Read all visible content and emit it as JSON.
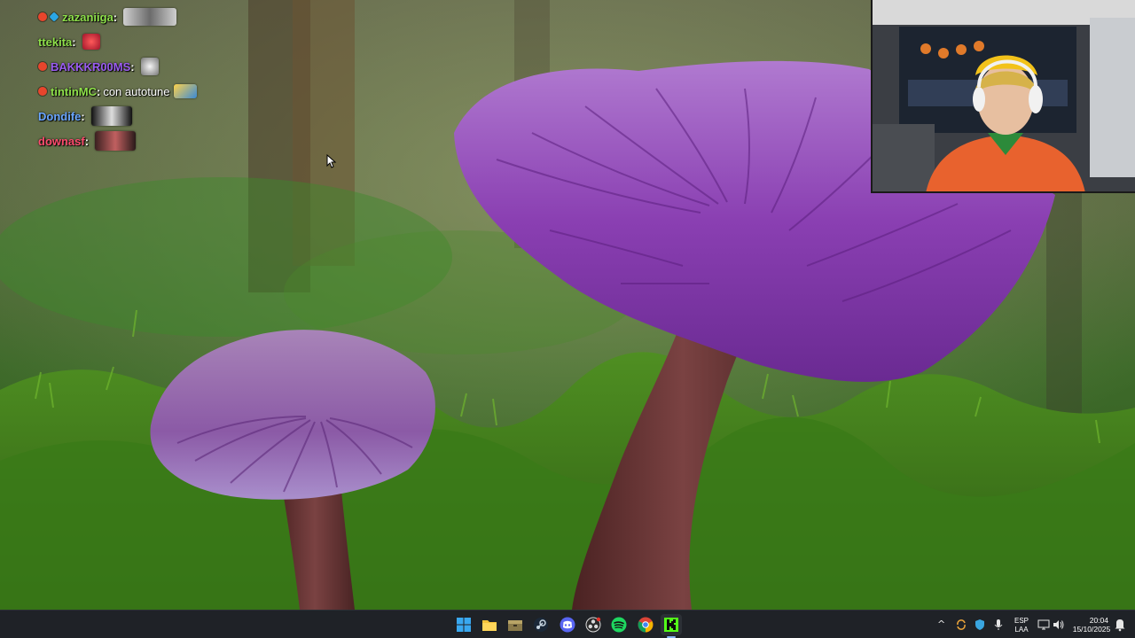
{
  "chat": {
    "messages": [
      {
        "user": "zazaniiga",
        "color": "#8ee04a",
        "badges": [
          "red",
          "blue"
        ],
        "text": ""
      },
      {
        "user": "ttekita",
        "color": "#8ee04a",
        "badges": [],
        "text": ""
      },
      {
        "user": "BAKKKR00MS",
        "color": "#9a5cf0",
        "badges": [
          "red"
        ],
        "text": ""
      },
      {
        "user": "tintinMC",
        "color": "#8ee04a",
        "badges": [
          "red"
        ],
        "text": "con autotune"
      },
      {
        "user": "Dondife",
        "color": "#6aa6ff",
        "badges": [],
        "text": ""
      },
      {
        "user": "downasf",
        "color": "#ff4b6e",
        "badges": [],
        "text": ""
      }
    ],
    "separator": ":"
  },
  "taskbar": {
    "apps": [
      {
        "name": "start-button",
        "icon": "windows-logo-icon"
      },
      {
        "name": "file-explorer-button",
        "icon": "folder-icon"
      },
      {
        "name": "game-launcher-button",
        "icon": "archive-icon"
      },
      {
        "name": "steam-button",
        "icon": "steam-icon"
      },
      {
        "name": "discord-button",
        "icon": "discord-icon"
      },
      {
        "name": "obs-button",
        "icon": "obs-icon"
      },
      {
        "name": "spotify-button",
        "icon": "spotify-icon"
      },
      {
        "name": "chrome-button",
        "icon": "chrome-icon"
      },
      {
        "name": "kick-button",
        "icon": "kick-icon"
      }
    ],
    "tray": {
      "language_top": "ESP",
      "language_bottom": "LAA",
      "time": "20:04",
      "date": "15/10/2025"
    }
  },
  "colors": {
    "taskbar_bg": "#1f2227",
    "mushroom_cap": "#8a4aa6",
    "moss": "#3f7a1e"
  }
}
